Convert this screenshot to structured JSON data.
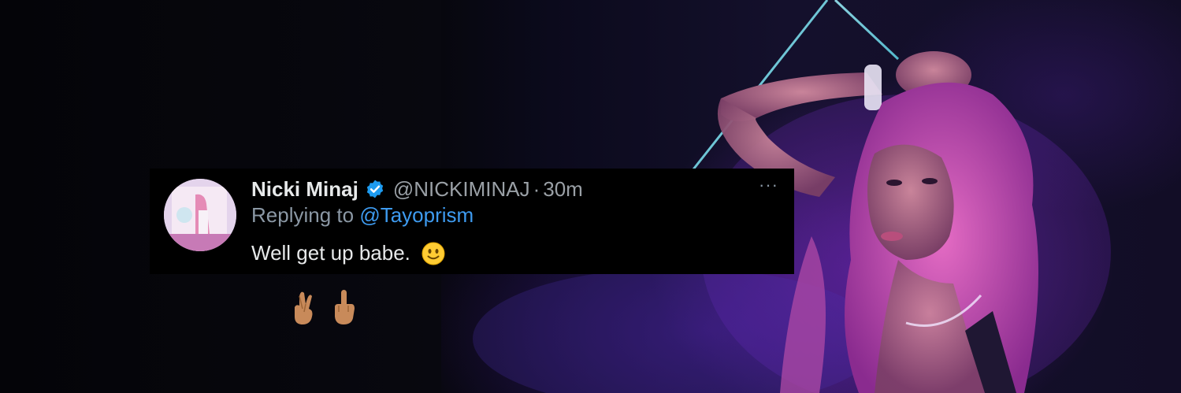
{
  "tweet": {
    "display_name": "Nicki Minaj",
    "handle": "@NICKIMINAJ",
    "separator": "·",
    "time": "30m",
    "more_label": "···",
    "replying_prefix": "Replying to",
    "replying_to": "@Tayoprism",
    "text": "Well get up babe."
  },
  "icons": {
    "verified": "verified-badge-icon",
    "smile": "slightly-smiling-face-emoji",
    "hand_1": "crossed-fingers-emoji",
    "hand_2": "middle-finger-emoji"
  },
  "colors": {
    "tweet_background": "#000000",
    "name": "#e7e9ea",
    "secondary": "#8b98a5",
    "mention": "#3e9bf0",
    "verified": "#1d9bf0",
    "glow": "#7a2fd0"
  }
}
